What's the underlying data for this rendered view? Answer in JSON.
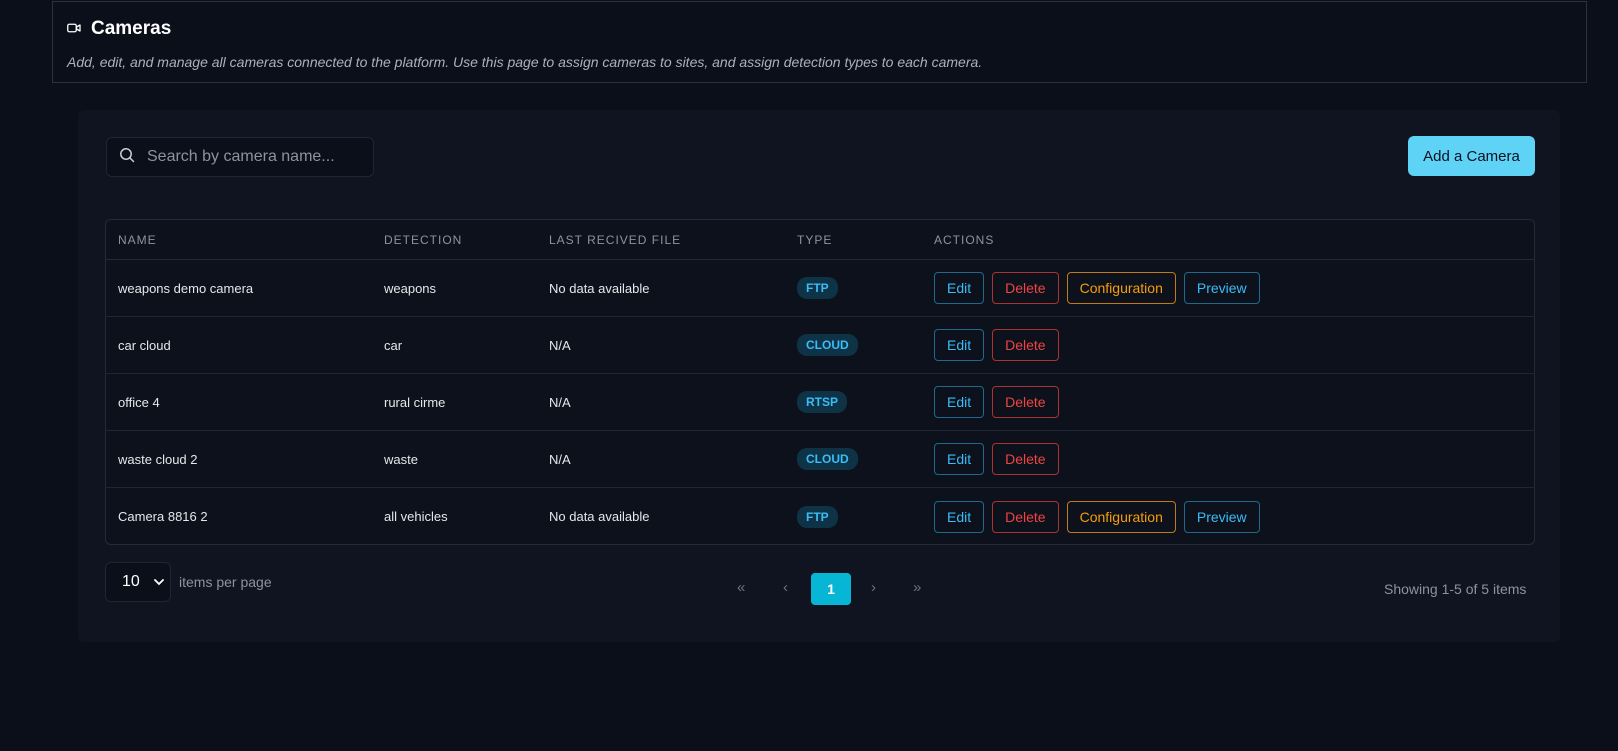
{
  "header": {
    "title": "Cameras",
    "description": "Add, edit, and manage all cameras connected to the platform. Use this page to assign cameras to sites, and assign detection types to each camera."
  },
  "search": {
    "placeholder": "Search by camera name..."
  },
  "add_button": "Add a Camera",
  "table": {
    "columns": [
      "NAME",
      "DETECTION",
      "LAST RECIVED FILE",
      "TYPE",
      "ACTIONS"
    ],
    "rows": [
      {
        "name": "weapons demo camera",
        "detection": "weapons",
        "last_file": "No data available",
        "type": "FTP",
        "actions": [
          "Edit",
          "Delete",
          "Configuration",
          "Preview"
        ]
      },
      {
        "name": "car cloud",
        "detection": "car",
        "last_file": "N/A",
        "type": "CLOUD",
        "actions": [
          "Edit",
          "Delete"
        ]
      },
      {
        "name": "office 4",
        "detection": "rural cirme",
        "last_file": "N/A",
        "type": "RTSP",
        "actions": [
          "Edit",
          "Delete"
        ]
      },
      {
        "name": "waste cloud 2",
        "detection": "waste",
        "last_file": "N/A",
        "type": "CLOUD",
        "actions": [
          "Edit",
          "Delete"
        ]
      },
      {
        "name": "Camera 8816 2",
        "detection": "all vehicles",
        "last_file": "No data available",
        "type": "FTP",
        "actions": [
          "Edit",
          "Delete",
          "Configuration",
          "Preview"
        ]
      }
    ]
  },
  "pagination": {
    "per_page": "10",
    "per_page_label": "items per page",
    "current_page": "1",
    "first": "«",
    "prev": "‹",
    "next": "›",
    "last": "»",
    "showing": "Showing 1-5 of 5 items"
  },
  "colors": {
    "accent": "#5fd3f5",
    "edit": "#38bdf8",
    "delete": "#ef4444",
    "configuration": "#f59e0b",
    "background": "#0b0f19"
  },
  "icons": {
    "title": "video-camera-icon",
    "search": "search-icon",
    "select": "chevron-down-icon"
  }
}
